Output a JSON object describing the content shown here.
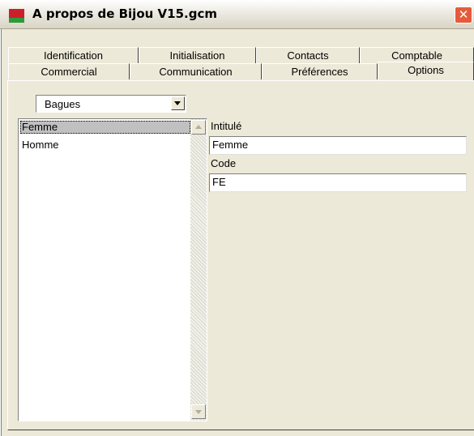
{
  "window": {
    "title": "A propos de Bijou V15.gcm",
    "close_label": "✕"
  },
  "tabs_row1": [
    {
      "label": "Identification"
    },
    {
      "label": "Initialisation"
    },
    {
      "label": "Contacts"
    },
    {
      "label": "Comptable"
    }
  ],
  "tabs_row2": [
    {
      "label": "Commercial"
    },
    {
      "label": "Communication"
    },
    {
      "label": "Préférences"
    },
    {
      "label": "Options",
      "active": true
    }
  ],
  "category_select": {
    "value": "Bagues"
  },
  "list": {
    "items": [
      "Femme",
      "Homme"
    ],
    "selected_index": 0
  },
  "form": {
    "intitule_label": "Intitulé",
    "intitule_value": "Femme",
    "code_label": "Code",
    "code_value": "FE"
  },
  "colors": {
    "face": "#ece9d8",
    "close": "#e65a3b",
    "selection": "#c0c0c0"
  }
}
